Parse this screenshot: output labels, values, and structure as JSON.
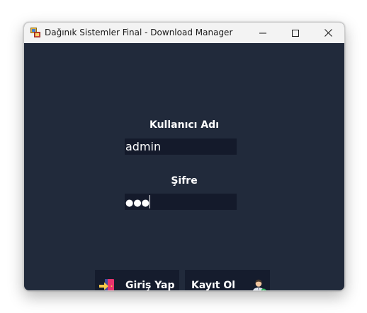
{
  "window": {
    "title": "Dağınık Sistemler Final - Download Manager",
    "controls": [
      "minimize",
      "maximize",
      "close"
    ]
  },
  "login": {
    "username_label": "Kullanıcı Adı",
    "username_value": "admin",
    "password_label": "Şifre",
    "password_masked": "●●●"
  },
  "buttons": {
    "login_label": "Giriş Yap",
    "login_icon": "login-door-icon",
    "register_label": "Kayıt Ol",
    "register_icon": "add-user-icon"
  },
  "colors": {
    "window_bg": "#212a3b",
    "field_bg": "#141a2b",
    "button_bg": "#151c2d",
    "titlebar_bg": "#f3f3f3",
    "text": "#ffffff"
  }
}
